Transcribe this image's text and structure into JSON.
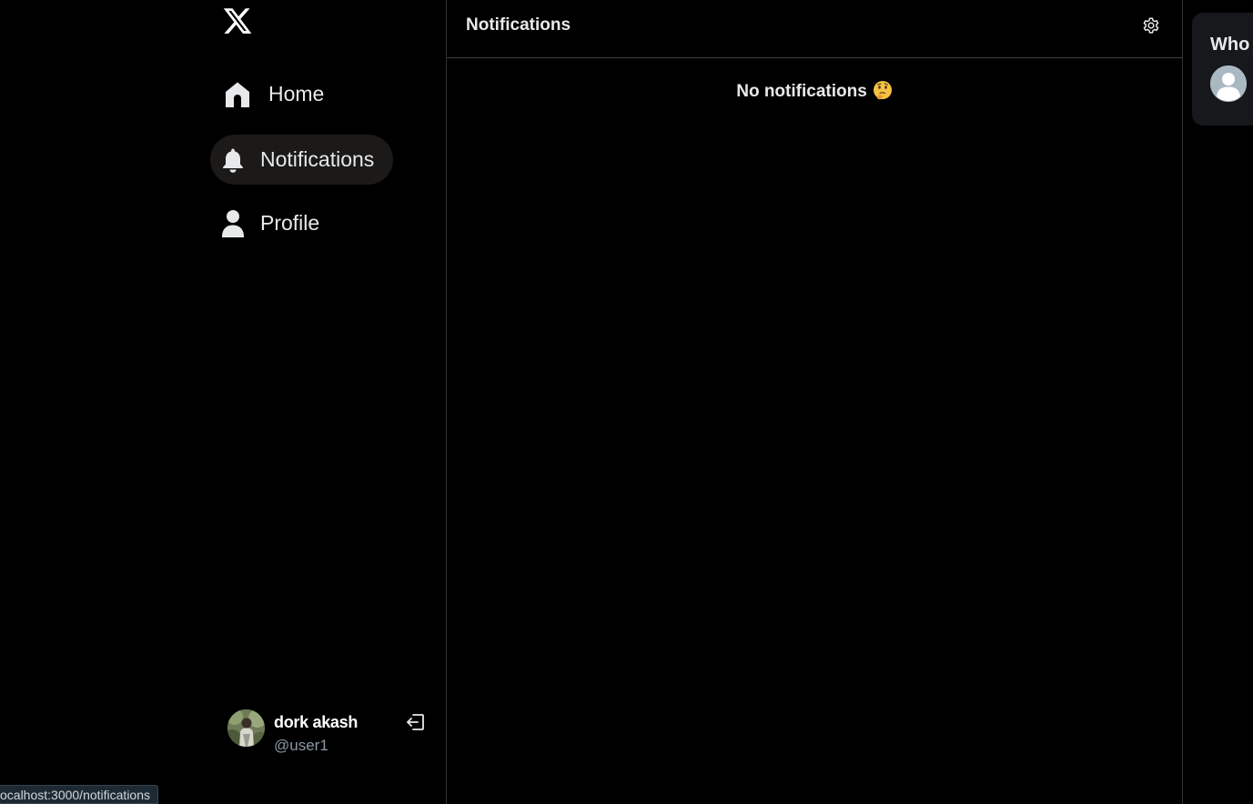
{
  "sidebar": {
    "logo_icon": "x-logo-icon",
    "items": [
      {
        "label": "Home",
        "icon": "home-icon",
        "active": false
      },
      {
        "label": "Notifications",
        "icon": "bell-icon",
        "active": true
      },
      {
        "label": "Profile",
        "icon": "person-icon",
        "active": false
      }
    ],
    "account": {
      "name": "dork akash",
      "handle": "@user1",
      "logout_icon": "logout-icon"
    }
  },
  "main": {
    "title": "Notifications",
    "settings_icon": "gear-icon",
    "empty_message": "No notifications",
    "empty_emoji": "thinking-face-emoji"
  },
  "right_panel": {
    "title": "Who"
  },
  "status_bar": {
    "url": "ocalhost:3000/notifications"
  },
  "colors": {
    "background": "#000000",
    "text": "#e7e9ea",
    "muted": "#8b98a5",
    "active_nav_bg": "#1c1a19",
    "panel_bg": "#16181c",
    "border": "#2f3336"
  }
}
